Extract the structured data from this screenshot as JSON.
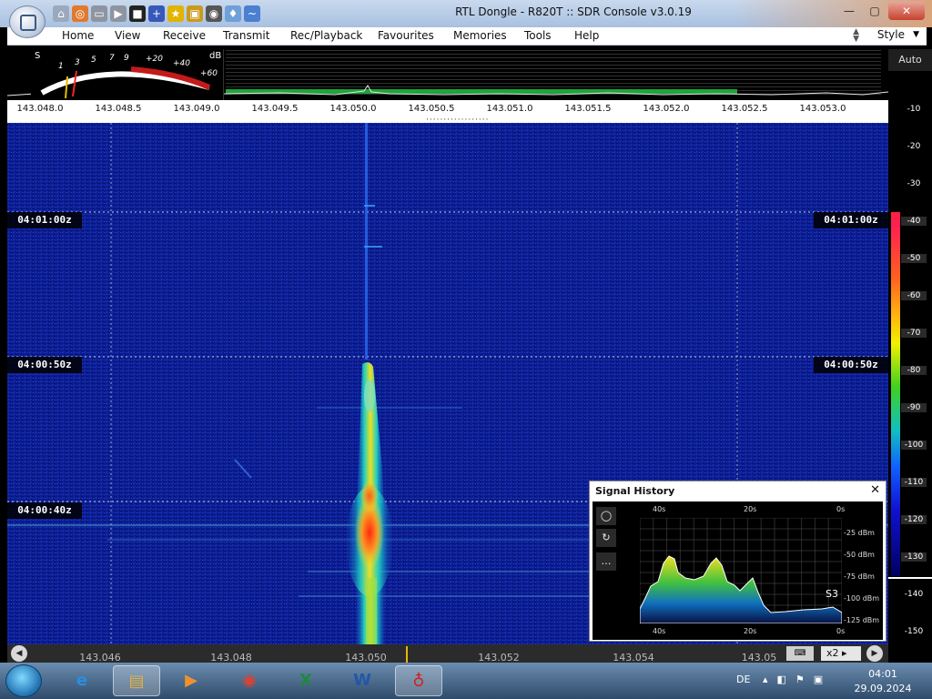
{
  "window": {
    "title": "RTL Dongle - R820T :: SDR Console v3.0.19",
    "controls": [
      "minimize",
      "maximize",
      "close"
    ]
  },
  "quick_access": [
    "home-icon",
    "lifebuoy-icon",
    "folder-icon",
    "play-icon",
    "stop-icon",
    "plus-icon",
    "star-icon",
    "lock-icon",
    "camera-icon",
    "drop-icon",
    "wave-icon"
  ],
  "menu": {
    "items": [
      "Home",
      "View",
      "Receive",
      "Transmit",
      "Rec/Playback",
      "Favourites",
      "Memories",
      "Tools",
      "Help"
    ],
    "style_label": "Style"
  },
  "smeter": {
    "s_label": "S",
    "db_label": "dB",
    "s_scale": [
      "1",
      "3",
      "5",
      "7",
      "9"
    ],
    "db_scale": [
      "+20",
      "+40",
      "+60"
    ]
  },
  "freq_axis": [
    "143.048.0",
    "143.048.5",
    "143.049.0",
    "143.049.5",
    "143.050.0",
    "143.050.5",
    "143.051.0",
    "143.051.5",
    "143.052.0",
    "143.052.5",
    "143.053.0"
  ],
  "waterfall": {
    "timestamps": [
      "04:01:00z",
      "04:00:50z",
      "04:00:40z"
    ]
  },
  "db_scale": {
    "auto_label": "Auto",
    "labels": [
      "-10",
      "-20",
      "-30",
      "-40",
      "-50",
      "-60",
      "-70",
      "-80",
      "-90",
      "-100",
      "-110",
      "-120",
      "-130",
      "-140",
      "-150"
    ]
  },
  "signal_history": {
    "title": "Signal History",
    "time_top": [
      "40s",
      "20s",
      "0s"
    ],
    "time_bottom": [
      "40s",
      "20s",
      "0s"
    ],
    "db_labels": [
      "-25 dBm",
      "-50 dBm",
      "-75 dBm",
      "-100 dBm",
      "-125 dBm"
    ],
    "s_reading": "S3",
    "tools": [
      "circle-icon",
      "refresh-icon",
      "more-icon"
    ]
  },
  "bottom_axis": [
    "143.046",
    "143.048",
    "143.050",
    "143.052",
    "143.054",
    "143.05"
  ],
  "zoom_label": "x2",
  "taskbar": {
    "language": "DE",
    "time": "04:01",
    "date": "29.09.2024",
    "apps": [
      "internet-explorer-icon",
      "file-explorer-icon",
      "media-player-icon",
      "chrome-icon",
      "excel-icon",
      "word-icon",
      "sdr-console-icon"
    ]
  },
  "colors": {
    "waterfall_bg": "#0a1a8a",
    "signal_peak": "#ff3010",
    "signal_bar": "#1ea53a",
    "accent": "#e4b800"
  }
}
